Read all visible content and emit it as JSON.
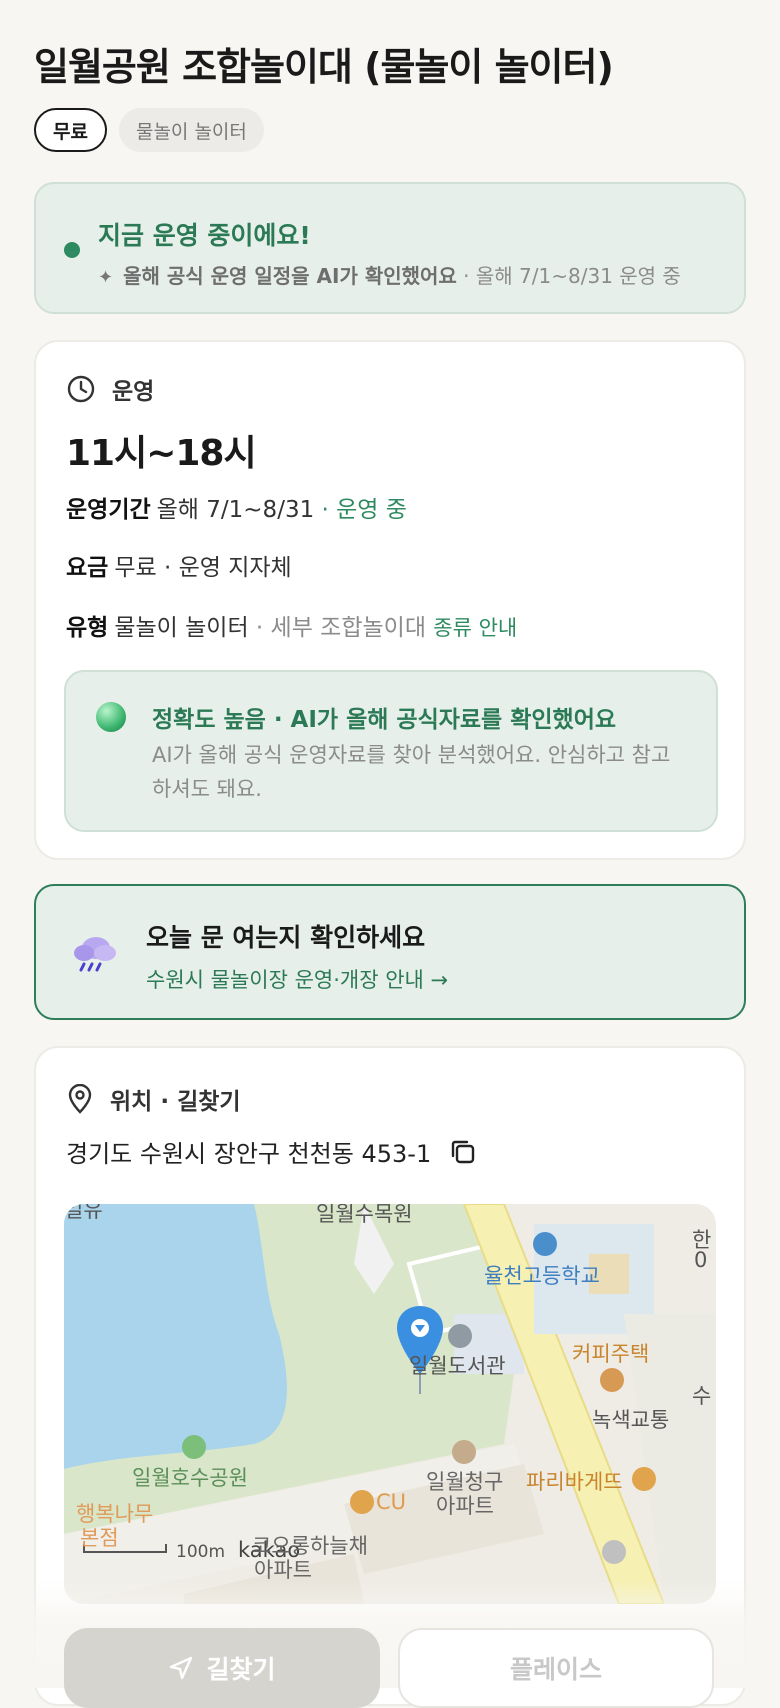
{
  "header": {
    "title": "일월공원 조합놀이대 (물놀이 놀이터)",
    "chips": [
      "무료",
      "물놀이 놀이터"
    ]
  },
  "status": {
    "title": "지금 운영 중이에요!",
    "sub_bold": "올해 공식 운영 일정을 AI가 확인했어요",
    "sub_rest": " · 올해 7/1~8/31 운영 중",
    "color": "#2e8a60"
  },
  "operation": {
    "heading": "운영",
    "hours": "11시~18시",
    "period_label": "운영기간",
    "period_value": "올해 7/1~8/31",
    "period_status": " · 운영 중",
    "fee_label": "요금",
    "fee_value": "무료 · 운영 지자체",
    "type_label": "유형",
    "type_value": "물놀이 놀이터",
    "type_detail": " · 세부 조합놀이대",
    "type_link": "종류 안내",
    "accuracy_title": "정확도 높음 · AI가 올해 공식자료를 확인했어요",
    "accuracy_desc": "AI가 올해 공식 운영자료를 찾아 분석했어요. 안심하고 참고하셔도 돼요."
  },
  "notice": {
    "title": "오늘 문 여는지 확인하세요",
    "link": "수원시 물놀이장 운영·개장 안내 →"
  },
  "location": {
    "heading": "위치 · 길찾기",
    "address": "경기도 수원시 장안구 천천동 453-1",
    "map_labels": {
      "top_left": "일유",
      "north": "일월수목원",
      "school": "율천고등학교",
      "school_right": "한",
      "school_right2": "0",
      "library": "일월도서관",
      "cafe1": "커피주택",
      "right1": "수",
      "right2": "녹색교통",
      "park": "일월호수공원",
      "apt1a": "일월청구",
      "apt1b": "아파트",
      "bakery": "파리바게뜨",
      "tree1": "행복나무",
      "tree2": "본점",
      "cu": "CU",
      "scale": "100m",
      "kakao": "kakao",
      "apt2a": "코오롱하늘채",
      "apt2b": "아파트"
    }
  },
  "actions": {
    "directions": "길찾기",
    "place": "플레이스"
  }
}
